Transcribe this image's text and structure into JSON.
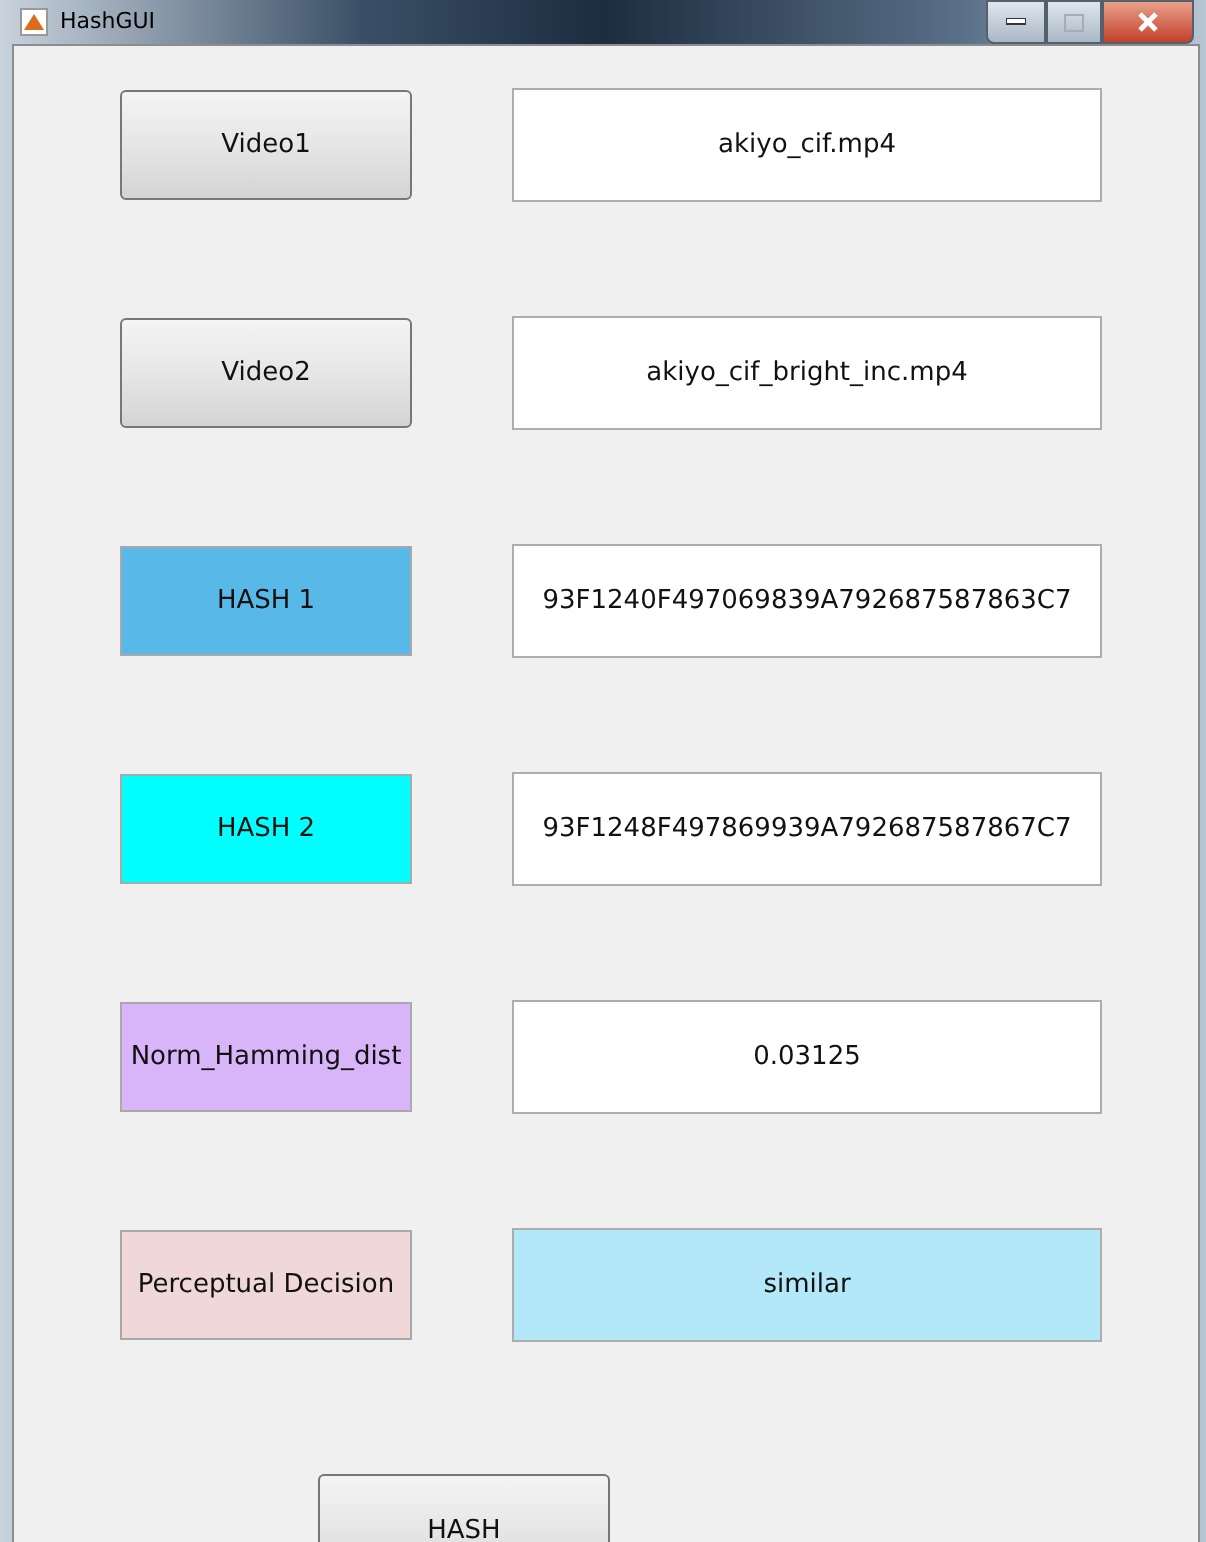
{
  "window": {
    "title": "HashGUI"
  },
  "rows": [
    {
      "left": {
        "kind": "button",
        "text": "Video1"
      },
      "right": {
        "kind": "field",
        "text": "akiyo_cif.mp4"
      }
    },
    {
      "left": {
        "kind": "button",
        "text": "Video2"
      },
      "right": {
        "kind": "field",
        "text": "akiyo_cif_bright_inc.mp4"
      }
    },
    {
      "left": {
        "kind": "label",
        "text": "HASH 1",
        "color": "#58b9e9"
      },
      "right": {
        "kind": "field",
        "text": "93F1240F497069839A792687587863C7"
      }
    },
    {
      "left": {
        "kind": "label",
        "text": "HASH 2",
        "color": "#00ffff"
      },
      "right": {
        "kind": "field",
        "text": "93F1248F497869939A792687587867C7"
      }
    },
    {
      "left": {
        "kind": "label",
        "text": "Norm_Hamming_dist",
        "color": "#d8b4f8"
      },
      "right": {
        "kind": "field",
        "text": "0.03125"
      }
    },
    {
      "left": {
        "kind": "label",
        "text": "Perceptual Decision",
        "color": "#f0d8d8"
      },
      "right": {
        "kind": "label",
        "text": "similar",
        "color": "#b3e8f8"
      }
    }
  ],
  "action": {
    "text": "HASH"
  }
}
